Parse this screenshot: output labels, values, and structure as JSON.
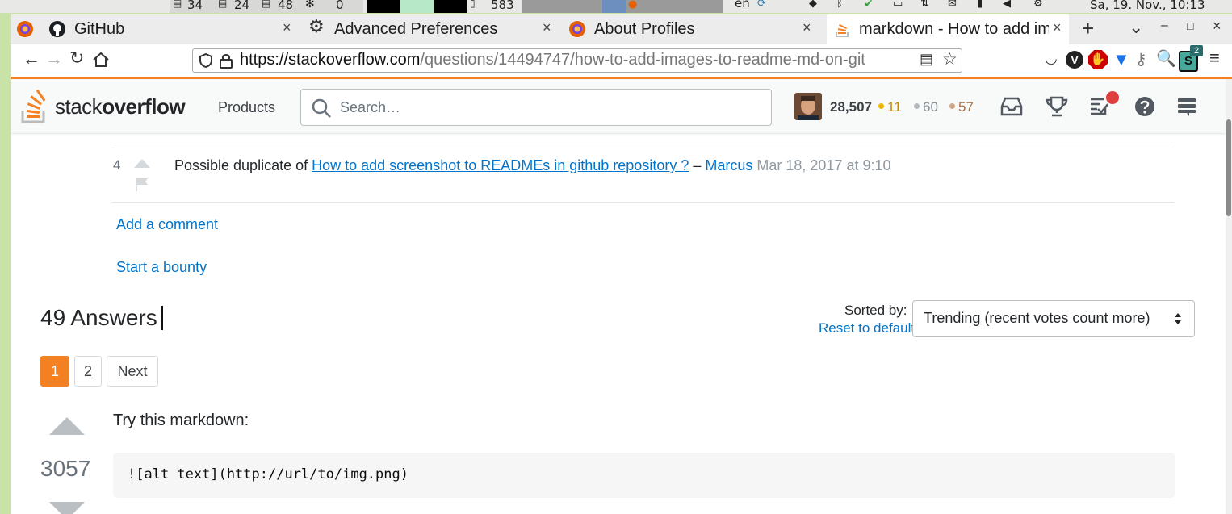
{
  "system_bar": {
    "stat1": "34",
    "stat2": "24",
    "stat3": "48",
    "stat4": "0",
    "stat5": "583",
    "keyboard_layout": "en",
    "clock": "Sa, 19. Nov., 10:13"
  },
  "tabs": [
    {
      "title": "GitHub",
      "close": "×"
    },
    {
      "title": "Advanced Preferences",
      "close": "×"
    },
    {
      "title": "About Profiles",
      "close": "×"
    },
    {
      "title": "markdown - How to add imag",
      "close": "×"
    }
  ],
  "tab_controls": {
    "new_tab": "+",
    "list": "⌄",
    "minimize": "–",
    "maximize": "□",
    "close": "×"
  },
  "navbar": {
    "url_host": "https://stackoverflow.com",
    "url_path": "/questions/14494747/how-to-add-images-to-readme-md-on-git",
    "extension_badge": "2"
  },
  "so_header": {
    "logo_light": "stack",
    "logo_bold": "overflow",
    "products": "Products",
    "search_placeholder": "Search…",
    "reputation": "28,507",
    "gold": "11",
    "silver": "60",
    "bronze": "57",
    "colors": {
      "gold": "#f1b600",
      "silver": "#9a9fa5",
      "bronze": "#d1a684",
      "accent": "#f48024"
    }
  },
  "comment": {
    "score": "4",
    "text_before": "Possible duplicate of ",
    "link_text": "How to add screenshot to READMEs in github repository ?",
    "dash": " – ",
    "user": "Marcus",
    "date": " Mar 18, 2017 at 9:10"
  },
  "actions": {
    "add_comment": "Add a comment",
    "start_bounty": "Start a bounty"
  },
  "answers_header": {
    "count_label": "49 Answers",
    "sorted_by": "Sorted by:",
    "reset": "Reset to default",
    "sort_value": "Trending (recent votes count more)"
  },
  "pagination": {
    "page1": "1",
    "page2": "2",
    "next": "Next"
  },
  "answer": {
    "votes": "3057",
    "intro": "Try this markdown:",
    "code": "![alt text](http://url/to/img.png)"
  }
}
